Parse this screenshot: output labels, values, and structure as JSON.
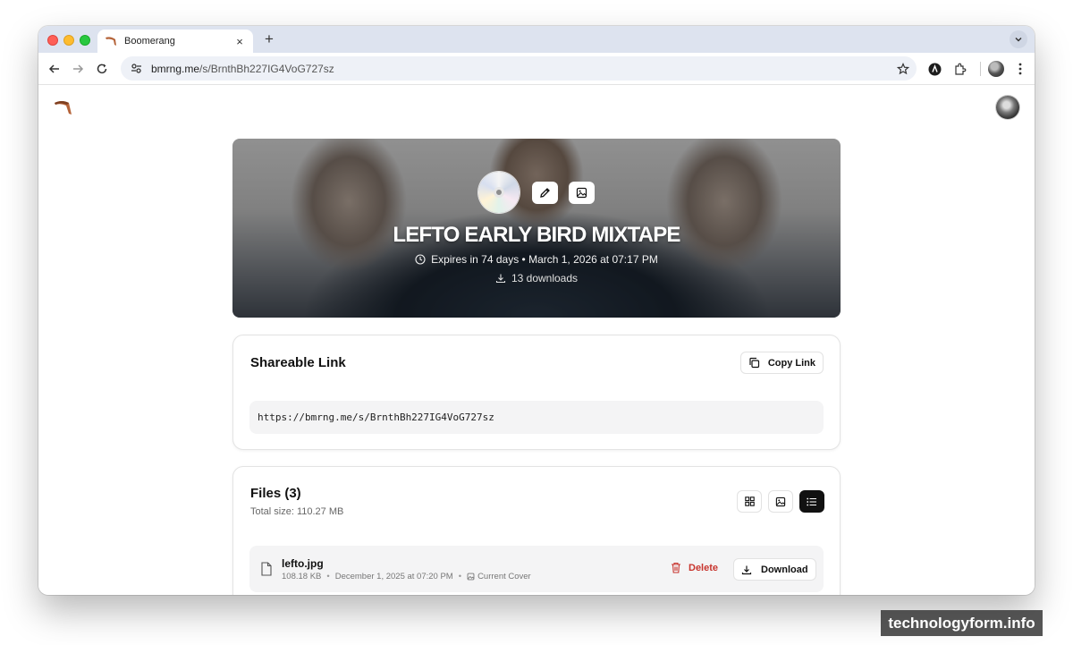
{
  "browser": {
    "tab_title": "Boomerang",
    "tab_close": "×",
    "new_tab": "+",
    "url_domain": "bmrng.me",
    "url_path": "/s/BrnthBh227IG4VoG727sz"
  },
  "hero": {
    "title": "LEFTO EARLY BIRD MIXTAPE",
    "expires": "Expires in 74 days • March 1, 2026 at 07:17 PM",
    "downloads": "13 downloads"
  },
  "share": {
    "title": "Shareable Link",
    "copy_label": "Copy Link",
    "link": "https://bmrng.me/s/BrnthBh227IG4VoG727sz"
  },
  "files": {
    "title": "Files (3)",
    "total_size": "Total size: 110.27 MB",
    "items": [
      {
        "name": "lefto.jpg",
        "size": "108.18 KB",
        "date": "December 1, 2025 at 07:20 PM",
        "tag": "Current Cover",
        "delete_label": "Delete",
        "download_label": "Download"
      }
    ]
  },
  "meta_separator": "•",
  "watermark": "technologyform.info",
  "colors": {
    "accent_dark": "#111111",
    "delete_red": "#c8352e",
    "tab_bar": "#dde3ef"
  }
}
